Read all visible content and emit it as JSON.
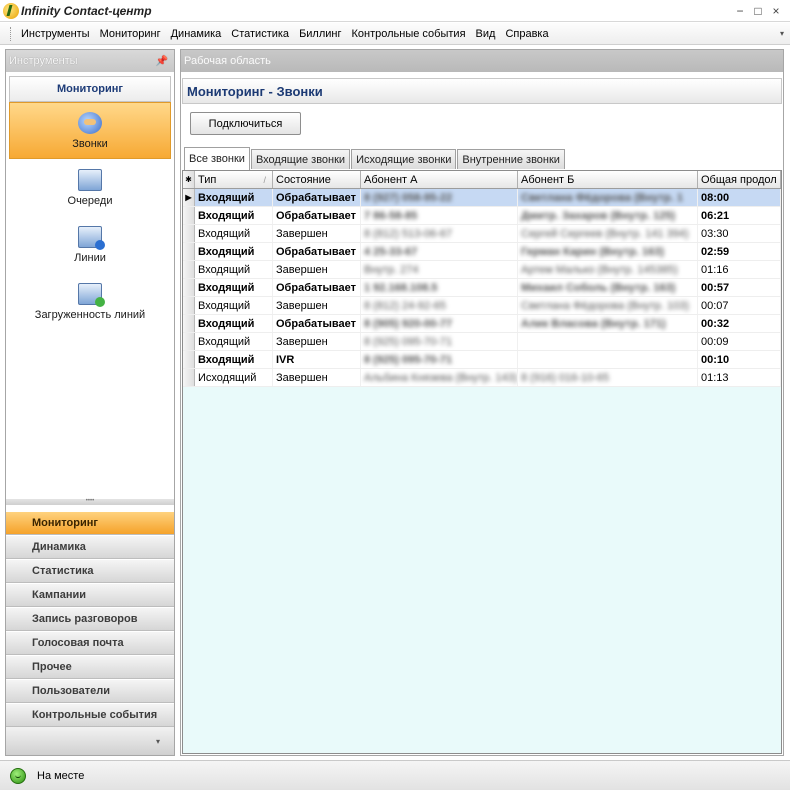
{
  "window": {
    "title": "Infinity Contact-центр",
    "controls": [
      "−",
      "□",
      "×"
    ]
  },
  "menu": {
    "items": [
      "Инструменты",
      "Мониторинг",
      "Динамика",
      "Статистика",
      "Биллинг",
      "Контрольные события",
      "Вид",
      "Справка"
    ]
  },
  "tools_panel": {
    "header": "Инструменты",
    "group_title": "Мониторинг",
    "items": [
      {
        "label": "Звонки",
        "icon": "phone-icon",
        "active": true
      },
      {
        "label": "Очереди",
        "icon": "queue-icon"
      },
      {
        "label": "Линии",
        "icon": "lines-icon"
      },
      {
        "label": "Загруженность линий",
        "icon": "line-load-icon"
      }
    ],
    "nav": [
      {
        "label": "Мониторинг",
        "active": true
      },
      {
        "label": "Динамика"
      },
      {
        "label": "Статистика"
      },
      {
        "label": "Кампании"
      },
      {
        "label": "Запись разговоров"
      },
      {
        "label": "Голосовая почта"
      },
      {
        "label": "Прочее"
      },
      {
        "label": "Пользователи"
      },
      {
        "label": "Контрольные события"
      }
    ]
  },
  "workspace": {
    "header": "Рабочая область",
    "title": "Мониторинг - Звонки",
    "connect_button": "Подключиться",
    "tabs": [
      "Все звонки",
      "Входящие звонки",
      "Исходящие звонки",
      "Внутренние звонки"
    ],
    "active_tab": 0
  },
  "grid": {
    "columns": [
      "Тип",
      "Состояние",
      "Абонент А",
      "Абонент Б",
      "Общая продол"
    ],
    "rows": [
      {
        "type": "Входящий",
        "state": "Обрабатывает",
        "a": "8 (927) 058-95-22",
        "b": "Светлана Фёдорова (Внутр. 1",
        "dur": "08:00",
        "bold": true,
        "selected": true
      },
      {
        "type": "Входящий",
        "state": "Обрабатывает",
        "a": "7 86-58-85",
        "b": "Дмитр. Захаров (Внутр. 125)",
        "dur": "06:21",
        "bold": true
      },
      {
        "type": "Входящий",
        "state": "Завершен",
        "a": "8 (812) 513-06-67",
        "b": "Сергей Сергеев (Внутр. 141 394)",
        "dur": "03:30"
      },
      {
        "type": "Входящий",
        "state": "Обрабатывает",
        "a": "4 25-33-67",
        "b": "Герман Карин (Внутр. 163)",
        "dur": "02:59",
        "bold": true
      },
      {
        "type": "Входящий",
        "state": "Завершен",
        "a": "Внутр. 274",
        "b": "Артем Малько (Внутр. 145385)",
        "dur": "01:16"
      },
      {
        "type": "Входящий",
        "state": "Обрабатывает",
        "a": "1 92.168.108.5",
        "b": "Михаил Соболь (Внутр. 163)",
        "dur": "00:57",
        "bold": true
      },
      {
        "type": "Входящий",
        "state": "Завершен",
        "a": "8 (812) 24-92-65",
        "b": "Светлана Фёдорова (Внутр. 103)",
        "dur": "00:07"
      },
      {
        "type": "Входящий",
        "state": "Обрабатывает",
        "a": "8 (905) 920-00-77",
        "b": "Алик Власова (Внутр. 171)",
        "dur": "00:32",
        "bold": true
      },
      {
        "type": "Входящий",
        "state": "Завершен",
        "a": "8 (925) 095-70-71",
        "b": "",
        "dur": "00:09"
      },
      {
        "type": "Входящий",
        "state": "IVR",
        "a": "8 (925) 095-70-71",
        "b": "",
        "dur": "00:10",
        "bold": true
      },
      {
        "type": "Исходящий",
        "state": "Завершен",
        "a": "Альбина Князева (Внутр. 143)",
        "b": "8 (916) 016-10-65",
        "dur": "01:13"
      }
    ]
  },
  "status": {
    "text": "На месте"
  }
}
